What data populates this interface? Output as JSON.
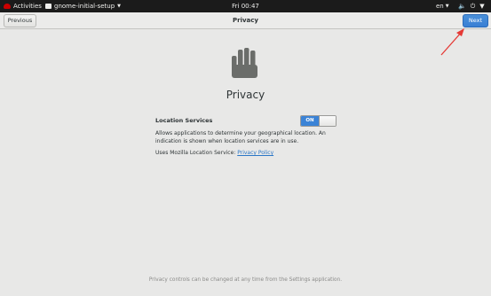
{
  "topbar": {
    "activities": "Activities",
    "app_menu": "gnome-initial-setup",
    "clock": "Fri 00:47",
    "language": "en"
  },
  "header": {
    "previous_label": "Previous",
    "title": "Privacy",
    "next_label": "Next"
  },
  "main": {
    "page_title": "Privacy",
    "location_services_label": "Location Services",
    "switch_state": "ON",
    "description": "Allows applications to determine your geographical location. An indication is shown when location services are in use.",
    "uses_prefix": "Uses Mozilla Location Service:",
    "privacy_policy_link": "Privacy Policy",
    "footer_note": "Privacy controls can be changed at any time from the Settings application."
  },
  "colors": {
    "accent": "#3b83d6",
    "annotation_arrow": "#e53935"
  },
  "icons": {
    "page_icon": "hand-icon",
    "topbar": [
      "redhat-icon",
      "app-icon",
      "volume-icon",
      "power-icon",
      "caret-down-icon"
    ]
  }
}
